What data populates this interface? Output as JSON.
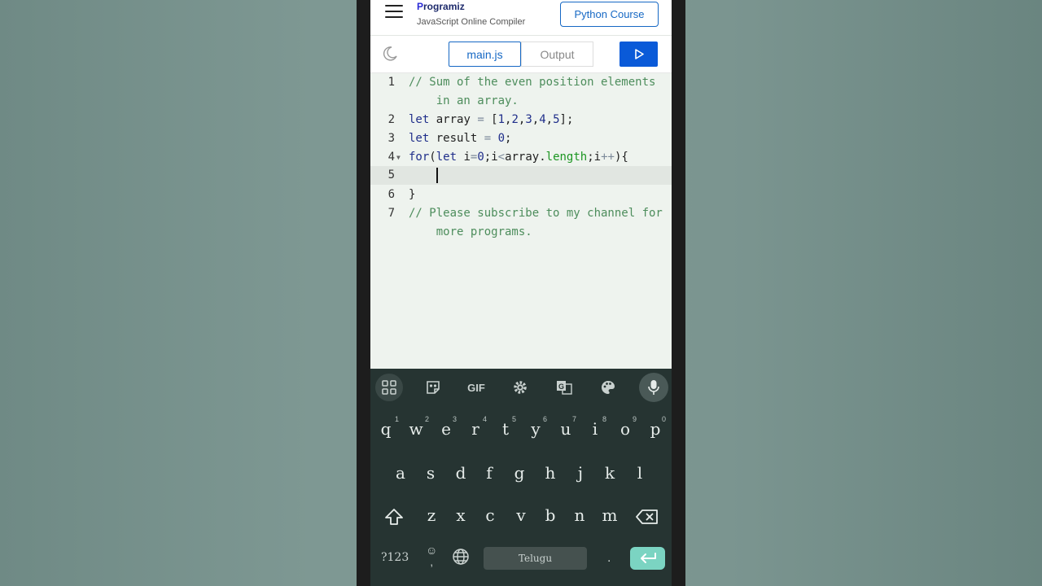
{
  "header": {
    "brand": "rogramiz",
    "brand_initial": "P",
    "subtitle": "JavaScript Online Compiler",
    "course_button": "Python Course"
  },
  "toolbar": {
    "tab_main": "main.js",
    "tab_output": "Output",
    "theme_icon": "moon-icon",
    "run_icon": "play-icon"
  },
  "editor": {
    "lines": [
      {
        "num": "1",
        "text": "// Sum of the even position elements"
      },
      {
        "num": "",
        "text": "    in an array."
      },
      {
        "num": "2",
        "text": "let array = [1,2,3,4,5];"
      },
      {
        "num": "3",
        "text": "let result = 0;"
      },
      {
        "num": "4",
        "text": "for(let i=0;i<array.length;i++){"
      },
      {
        "num": "5",
        "text": ""
      },
      {
        "num": "6",
        "text": "}"
      },
      {
        "num": "7",
        "text": "// Please subscribe to my channel for"
      },
      {
        "num": "",
        "text": "    more programs."
      }
    ],
    "active_line": "5"
  },
  "keyboard": {
    "toolbar_icons": [
      "apps-icon",
      "sticker-icon",
      "gif-icon",
      "settings-icon",
      "translate-icon",
      "palette-icon",
      "mic-icon"
    ],
    "gif_label": "GIF",
    "row1": [
      "q",
      "w",
      "e",
      "r",
      "t",
      "y",
      "u",
      "i",
      "o",
      "p"
    ],
    "row1_hints": [
      "1",
      "2",
      "3",
      "4",
      "5",
      "6",
      "7",
      "8",
      "9",
      "0"
    ],
    "row2": [
      "a",
      "s",
      "d",
      "f",
      "g",
      "h",
      "j",
      "k",
      "l"
    ],
    "row3": [
      "z",
      "x",
      "c",
      "v",
      "b",
      "n",
      "m"
    ],
    "symbols_label": "?123",
    "comma_label": ",",
    "space_label": "Telugu",
    "period_label": ".",
    "colors": {
      "keyboard_bg": "#263432",
      "enter": "#7bd4c2",
      "accent": "#1668c4",
      "run": "#0a5ad8"
    }
  }
}
